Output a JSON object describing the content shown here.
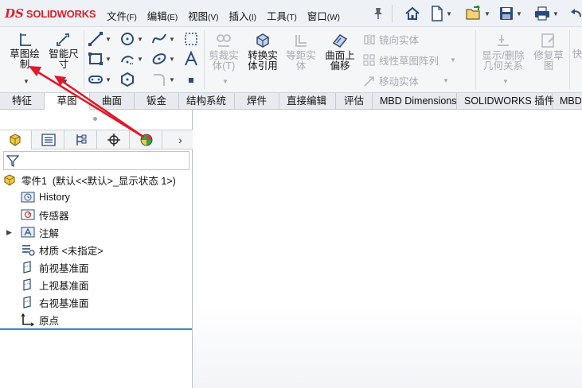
{
  "app": {
    "logo_mark": "DS",
    "logo_text": "SOLIDWORKS"
  },
  "menu": [
    {
      "label": "文件",
      "accel": "(F)"
    },
    {
      "label": "编辑",
      "accel": "(E)"
    },
    {
      "label": "视图",
      "accel": "(V)"
    },
    {
      "label": "插入",
      "accel": "(I)"
    },
    {
      "label": "工具",
      "accel": "(T)"
    },
    {
      "label": "窗口",
      "accel": "(W)"
    }
  ],
  "quick_access": [
    "home-icon",
    "new-document-icon",
    "open-icon",
    "save-icon",
    "print-icon",
    "undo-icon"
  ],
  "toolbar": {
    "sketch": "草图绘\n制",
    "smart_dim": "智能尺\n寸",
    "trim": "剪裁实\n体(T)",
    "convert": "转换实\n体引用",
    "offset": "等距实\n体",
    "surface_offset": "曲面上\n偏移",
    "mirror": "镜向实体",
    "linear_pattern": "线性草图阵列",
    "move": "移动实体",
    "show_delete": "显示/删除\n几何关系",
    "repair": "修复草\n图",
    "quick": "快"
  },
  "tabs": [
    {
      "label": "特征",
      "active": false
    },
    {
      "label": "草图",
      "active": true
    },
    {
      "label": "曲面",
      "active": false
    },
    {
      "label": "钣金",
      "active": false
    },
    {
      "label": "结构系统",
      "active": false
    },
    {
      "label": "焊件",
      "active": false
    },
    {
      "label": "直接编辑",
      "active": false
    },
    {
      "label": "评估",
      "active": false
    },
    {
      "label": "MBD Dimensions",
      "active": false
    },
    {
      "label": "SOLIDWORKS 插件",
      "active": false
    },
    {
      "label": "MBD",
      "active": false
    }
  ],
  "tree": {
    "root": "零件1  (默认<<默认>_显示状态 1>)",
    "items": [
      {
        "label": "History",
        "icon": "history-icon"
      },
      {
        "label": "传感器",
        "icon": "sensor-icon"
      },
      {
        "label": "注解",
        "icon": "annotation-icon"
      },
      {
        "label": "材质 <未指定>",
        "icon": "material-icon"
      },
      {
        "label": "前视基准面",
        "icon": "plane-icon"
      },
      {
        "label": "上视基准面",
        "icon": "plane-icon"
      },
      {
        "label": "右视基准面",
        "icon": "plane-icon"
      },
      {
        "label": "原点",
        "icon": "origin-icon"
      }
    ]
  },
  "colors": {
    "brand": "#d8232a",
    "annotation_arrow": "#e0182a",
    "accent": "#3b86c4"
  }
}
